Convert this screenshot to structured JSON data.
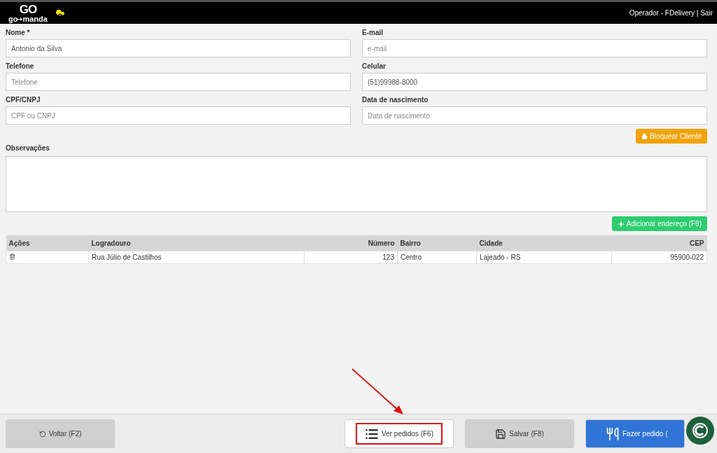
{
  "header": {
    "logo": {
      "mark": "GO",
      "name_start": "go",
      "name_end": "manda"
    },
    "operator": "Operador - FDelivery",
    "separator": "|",
    "logout": "Sair"
  },
  "fields": [
    {
      "label": "Nome *",
      "value": "Antonio da Silva"
    },
    {
      "label": "E-mail",
      "placeholder": "e-mail"
    },
    {
      "label": "Telefone",
      "placeholder": "Telefone"
    },
    {
      "label": "Celular",
      "value": "(51)99988-8000"
    },
    {
      "label": "CPF/CNPJ",
      "placeholder": "CPF ou CNPJ"
    },
    {
      "label": "Data de nascimento",
      "placeholder": "Data de nascimento"
    }
  ],
  "block_button": "Bloquear Cliente",
  "notes": {
    "label": "Observações"
  },
  "add_address_button": "Adicionar endereço (F9)",
  "table": {
    "columns": [
      "Ações",
      "Logradouro",
      "Número",
      "Bairro",
      "Cidade",
      "CEP"
    ],
    "rows": [
      {
        "street": "Rua Júlio de Castilhos",
        "number": "123",
        "district": "Centro",
        "city": "Lajeado - RS",
        "zip": "95900-022"
      }
    ]
  },
  "footer": [
    {
      "kind": "back",
      "label": "Voltar (F2)"
    },
    {
      "kind": "orders",
      "label": "Ver pedidos (F6)"
    },
    {
      "kind": "save",
      "label": "Salvar (F8)"
    },
    {
      "kind": "order",
      "label": "Fazer pedido ("
    }
  ]
}
